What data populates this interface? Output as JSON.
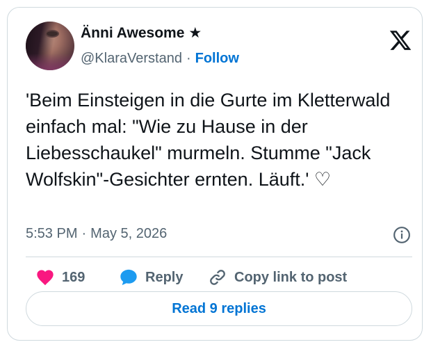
{
  "author": {
    "display_name": "Änni Awesome",
    "badge": "★",
    "handle": "@KlaraVerstand",
    "separator": "·",
    "follow_label": "Follow"
  },
  "tweet": {
    "text": "'Beim Einsteigen in die Gurte im Kletterwald einfach mal: \"Wie zu Hause in der Liebesschaukel\" murmeln. Stumme \"Jack Wolfskin\"-Gesichter ernten. Läuft.' ♡",
    "time": "5:53 PM",
    "meta_separator": "·",
    "date": "May 5, 2026"
  },
  "actions": {
    "like_count": "169",
    "reply_label": "Reply",
    "copy_label": "Copy link to post"
  },
  "read_replies_label": "Read 9 replies",
  "icons": [
    "x-logo-icon",
    "info-icon",
    "heart-icon",
    "reply-bubble-icon",
    "link-icon"
  ],
  "colors": {
    "accent": "#0074d4",
    "like": "#f91880",
    "reply_icon": "#1d9bf0",
    "secondary_text": "#536471",
    "border": "#cfd9de"
  }
}
